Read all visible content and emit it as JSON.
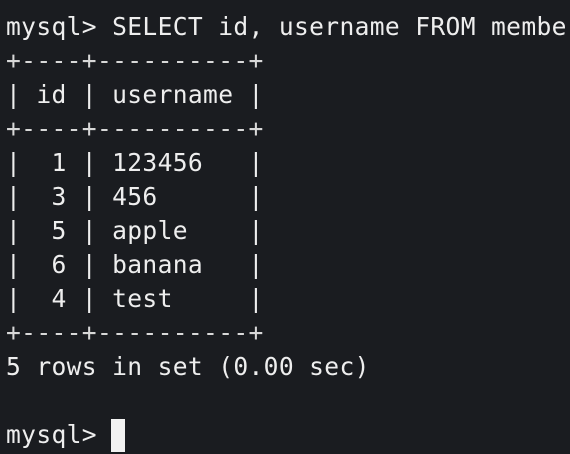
{
  "terminal": {
    "command_line": "mysql> SELECT id, username FROM member;",
    "table_border": "+----+----------+",
    "table_header": "| id | username |",
    "rows": [
      "|  1 | 123456   |",
      "|  3 | 456      |",
      "|  5 | apple    |",
      "|  6 | banana   |",
      "|  4 | test     |"
    ],
    "result_summary": "5 rows in set (0.00 sec)",
    "prompt": "mysql>",
    "colors": {
      "background": "#1a1c20",
      "text": "#eeeeee",
      "cursor": "#f2f2f2"
    }
  }
}
